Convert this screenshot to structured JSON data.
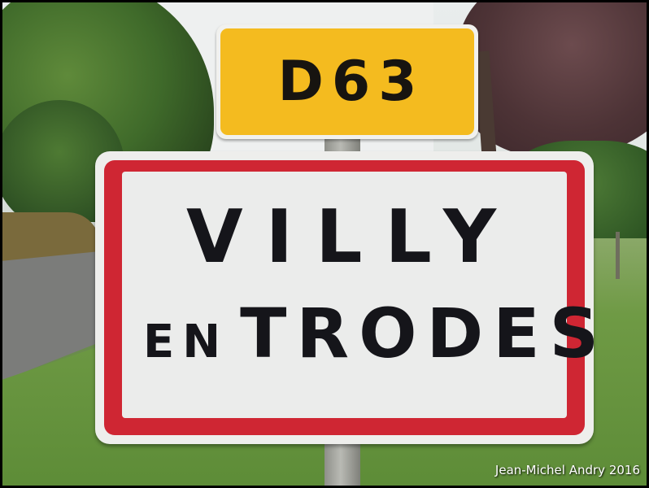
{
  "route_sign": {
    "text": "D63",
    "background_color": "#f4bb1f"
  },
  "place_sign": {
    "line1": "VILLY",
    "line2_prefix": "EN",
    "line2_name": "TRODES",
    "border_color": "#cf2633"
  },
  "photo_credit": "Jean-Michel Andry 2016"
}
